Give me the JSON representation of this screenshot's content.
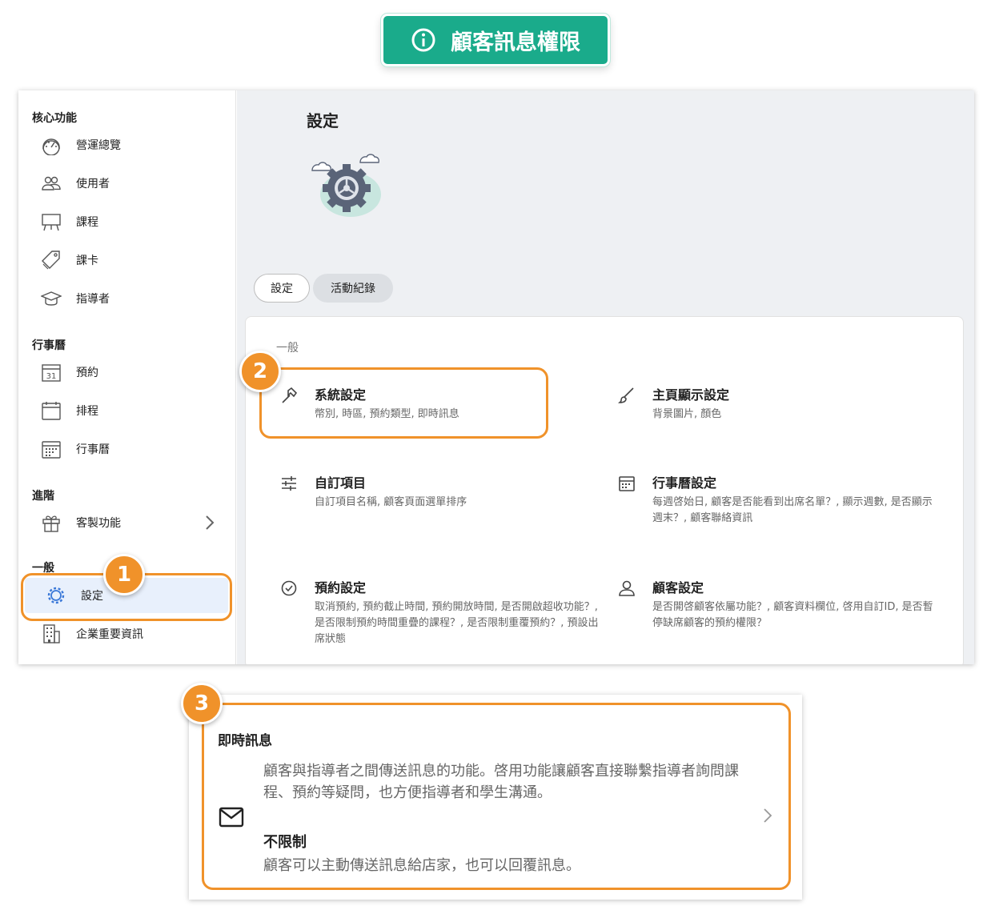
{
  "header": {
    "title": "顧客訊息權限",
    "accent_color": "#1aab8b",
    "icon": "info-icon"
  },
  "sidebar": {
    "sections": {
      "core": "核心功能",
      "calendar": "行事曆",
      "advanced": "進階",
      "general": "一般"
    },
    "items": [
      {
        "label": "營運總覽",
        "icon": "dashboard-icon"
      },
      {
        "label": "使用者",
        "icon": "users-icon"
      },
      {
        "label": "課程",
        "icon": "easel-icon"
      },
      {
        "label": "課卡",
        "icon": "tags-icon"
      },
      {
        "label": "指導者",
        "icon": "graduation-cap-icon"
      },
      {
        "label": "預約",
        "icon": "calendar-31-icon"
      },
      {
        "label": "排程",
        "icon": "calendar-icon"
      },
      {
        "label": "行事曆",
        "icon": "calendar-grid-icon"
      },
      {
        "label": "客製功能",
        "icon": "gift-icon"
      },
      {
        "label": "設定",
        "icon": "gear-icon"
      },
      {
        "label": "企業重要資訊",
        "icon": "building-icon"
      }
    ]
  },
  "main": {
    "title": "設定",
    "tabs": [
      {
        "label": "設定"
      },
      {
        "label": "活動紀錄"
      }
    ],
    "section_label": "一般",
    "settings": [
      {
        "title": "系統設定",
        "desc": "幣別, 時區, 預約類型, 即時訊息",
        "icon": "hammer-icon"
      },
      {
        "title": "主頁顯示設定",
        "desc": "背景圖片, 顏色",
        "icon": "brush-icon"
      },
      {
        "title": "自訂項目",
        "desc": "自訂項目名稱, 顧客頁面選單排序",
        "icon": "sliders-icon"
      },
      {
        "title": "行事曆設定",
        "desc": "每週啓始日, 顧客是否能看到出席名單？, 顯示週數, 是否顯示週末？, 顧客聯絡資訊",
        "icon": "calendar-icon"
      },
      {
        "title": "預約設定",
        "desc": "取消預約, 預約截止時間, 預約開放時間, 是否開啟超收功能？, 是否限制預約時間重疊的課程？, 是否限制重覆預約？, 預設出席狀態",
        "icon": "check-circle-icon"
      },
      {
        "title": "顧客設定",
        "desc": "是否開啓顧客依屬功能？, 顧客資料欄位, 啓用自訂ID, 是否暫停缺席顧客的預約權限？",
        "icon": "person-icon"
      }
    ]
  },
  "callouts": {
    "b1": "1",
    "b2": "2",
    "b3": "3",
    "color": "#f0922a"
  },
  "detail": {
    "title": "即時訊息",
    "desc": "顧客與指導者之間傳送訊息的功能。啓用功能讓顧客直接聯繫指導者詢問課程、預約等疑問，也方便指導者和學生溝通。",
    "option_title": "不限制",
    "option_desc": "顧客可以主動傳送訊息給店家，也可以回覆訊息。",
    "icon": "envelope-icon"
  }
}
